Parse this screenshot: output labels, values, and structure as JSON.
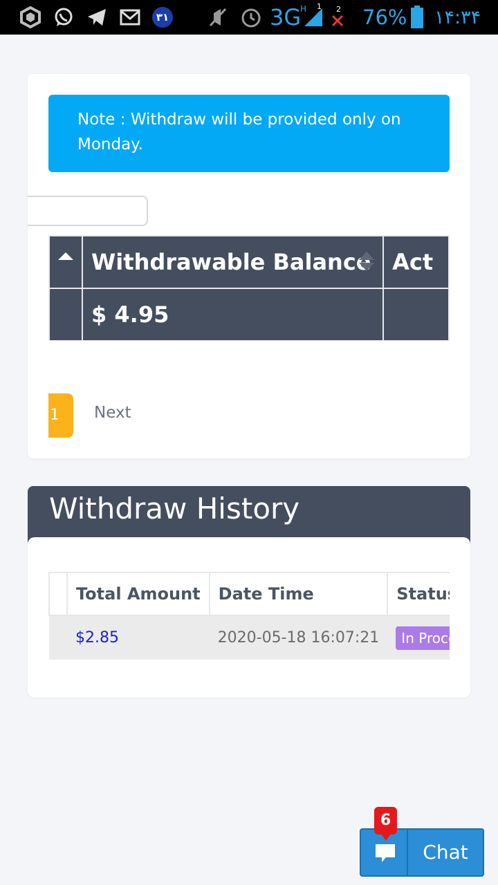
{
  "status_bar": {
    "network": "3G",
    "network_sub": "H",
    "sim1": "1",
    "sim2": "2",
    "battery": "76%",
    "battery_level": 0.76,
    "time": "۱۴:۳۴",
    "calendar_day": "۳۱",
    "icons": [
      "app-icon",
      "whatsapp-icon",
      "telegram-icon",
      "mail-icon",
      "calendar-icon",
      "mute-icon",
      "alarm-icon",
      "signal-icon",
      "no-signal-icon",
      "battery-icon"
    ]
  },
  "balance_card": {
    "note": "Note : Withdraw will be provided only on Monday.",
    "search_value": "",
    "table": {
      "headers": [
        "",
        "Withdrawable Balance",
        "Act"
      ],
      "rows": [
        [
          "",
          "$ 4.95",
          ""
        ]
      ]
    },
    "pagination": {
      "current_page": "1",
      "next_label": "Next"
    }
  },
  "history": {
    "title": "Withdraw History",
    "table": {
      "headers": [
        "",
        "Total Amount",
        "Date Time",
        "Status"
      ],
      "rows": [
        {
          "amount": "$2.85",
          "datetime": "2020-05-18 16:07:21",
          "status": "In Processing"
        }
      ]
    }
  },
  "chat": {
    "label": "Chat",
    "unread": "6"
  },
  "colors": {
    "note_bg": "#03a9f4",
    "table_dark": "#444e5f",
    "page_active": "#fcb21b",
    "status_badge": "#ab7be8",
    "chat_button": "#2b8ed6",
    "chat_badge": "#e5191c",
    "amount_text": "#1e20d6"
  }
}
